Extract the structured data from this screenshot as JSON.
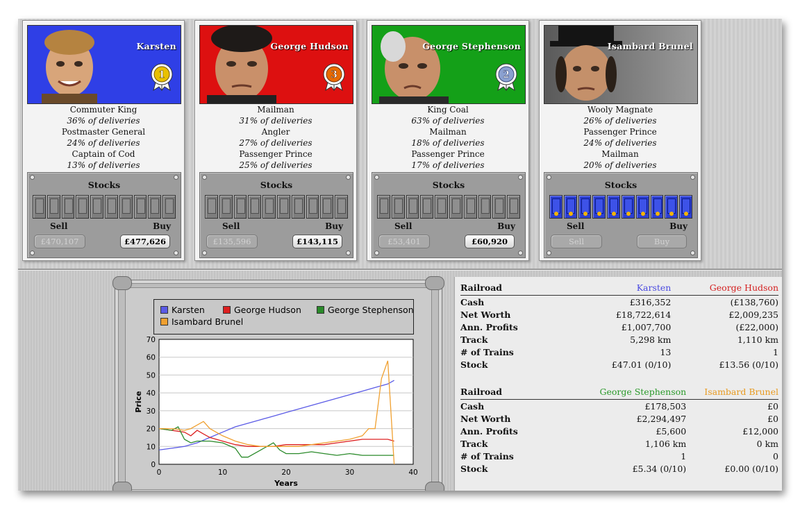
{
  "players": [
    {
      "name": "Karsten",
      "rank": "1",
      "bg": "#2f3fe6",
      "rank_color": "#e8c000",
      "achievements": [
        {
          "title": "Commuter King",
          "pct": "36% of deliveries"
        },
        {
          "title": "Postmaster General",
          "pct": "24% of deliveries"
        },
        {
          "title": "Captain of Cod",
          "pct": "13% of deliveries"
        }
      ],
      "stocks_label": "Stocks",
      "sell_label": "Sell",
      "buy_label": "Buy",
      "sell_value": "£470,107",
      "buy_value": "£477,626",
      "owned": 0,
      "buy_enabled": true
    },
    {
      "name": "George Hudson",
      "rank": "3",
      "bg": "#dd1010",
      "rank_color": "#e86a00",
      "achievements": [
        {
          "title": "Mailman",
          "pct": "31% of deliveries"
        },
        {
          "title": "Angler",
          "pct": "27% of deliveries"
        },
        {
          "title": "Passenger Prince",
          "pct": "25% of deliveries"
        }
      ],
      "stocks_label": "Stocks",
      "sell_label": "Sell",
      "buy_label": "Buy",
      "sell_value": "£135,596",
      "buy_value": "£143,115",
      "owned": 0,
      "buy_enabled": true
    },
    {
      "name": "George Stephenson",
      "rank": "2",
      "bg": "#14a018",
      "rank_color": "#8aa0d0",
      "achievements": [
        {
          "title": "King Coal",
          "pct": "63% of deliveries"
        },
        {
          "title": "Mailman",
          "pct": "18% of deliveries"
        },
        {
          "title": "Passenger Prince",
          "pct": "17% of deliveries"
        }
      ],
      "stocks_label": "Stocks",
      "sell_label": "Sell",
      "buy_label": "Buy",
      "sell_value": "£53,401",
      "buy_value": "£60,920",
      "owned": 0,
      "buy_enabled": true
    },
    {
      "name": "Isambard Brunel",
      "rank": "",
      "bg": "#7a7a7a",
      "rank_color": "",
      "achievements": [
        {
          "title": "Wooly Magnate",
          "pct": "26% of deliveries"
        },
        {
          "title": "Passenger Prince",
          "pct": "24% of deliveries"
        },
        {
          "title": "Mailman",
          "pct": "20% of deliveries"
        }
      ],
      "stocks_label": "Stocks",
      "sell_label": "Sell",
      "buy_label": "Buy",
      "sell_value": "Sell",
      "buy_value": "Buy",
      "owned": 10,
      "buy_enabled": false
    }
  ],
  "chart_data": {
    "type": "line",
    "xlabel": "Years",
    "ylabel": "Price",
    "xlim": [
      0,
      40
    ],
    "ylim": [
      0,
      70
    ],
    "xticks": [
      0,
      10,
      20,
      30,
      40
    ],
    "yticks": [
      0,
      10,
      20,
      30,
      40,
      50,
      60,
      70
    ],
    "grid": "horizontal",
    "legend_placement": "top",
    "series": [
      {
        "name": "Karsten",
        "color": "#5a5ae6",
        "points": [
          [
            0,
            8
          ],
          [
            2,
            9
          ],
          [
            4,
            10
          ],
          [
            6,
            12
          ],
          [
            8,
            15
          ],
          [
            10,
            18
          ],
          [
            12,
            21
          ],
          [
            14,
            23
          ],
          [
            16,
            25
          ],
          [
            18,
            27
          ],
          [
            20,
            29
          ],
          [
            22,
            31
          ],
          [
            24,
            33
          ],
          [
            26,
            35
          ],
          [
            28,
            37
          ],
          [
            30,
            39
          ],
          [
            32,
            41
          ],
          [
            34,
            43
          ],
          [
            36,
            45
          ],
          [
            37,
            47
          ]
        ]
      },
      {
        "name": "George Hudson",
        "color": "#dd2020",
        "points": [
          [
            0,
            20
          ],
          [
            2,
            19
          ],
          [
            4,
            18
          ],
          [
            5,
            16
          ],
          [
            6,
            19
          ],
          [
            7,
            17
          ],
          [
            8,
            15
          ],
          [
            10,
            13
          ],
          [
            12,
            11
          ],
          [
            14,
            10
          ],
          [
            16,
            10
          ],
          [
            18,
            10
          ],
          [
            20,
            11
          ],
          [
            22,
            11
          ],
          [
            24,
            11
          ],
          [
            26,
            11
          ],
          [
            28,
            12
          ],
          [
            30,
            13
          ],
          [
            32,
            14
          ],
          [
            34,
            14
          ],
          [
            36,
            14
          ],
          [
            37,
            13
          ]
        ]
      },
      {
        "name": "George Stephenson",
        "color": "#2a8a2a",
        "points": [
          [
            0,
            20
          ],
          [
            2,
            19
          ],
          [
            3,
            21
          ],
          [
            4,
            14
          ],
          [
            5,
            12
          ],
          [
            6,
            13
          ],
          [
            8,
            13
          ],
          [
            10,
            12
          ],
          [
            12,
            9
          ],
          [
            13,
            4
          ],
          [
            14,
            4
          ],
          [
            16,
            8
          ],
          [
            18,
            12
          ],
          [
            19,
            8
          ],
          [
            20,
            6
          ],
          [
            22,
            6
          ],
          [
            24,
            7
          ],
          [
            26,
            6
          ],
          [
            28,
            5
          ],
          [
            30,
            6
          ],
          [
            32,
            5
          ],
          [
            34,
            5
          ],
          [
            36,
            5
          ],
          [
            37,
            5
          ]
        ]
      },
      {
        "name": "Isambard Brunel",
        "color": "#f0a030",
        "points": [
          [
            0,
            20
          ],
          [
            2,
            20
          ],
          [
            4,
            19
          ],
          [
            5,
            20
          ],
          [
            6,
            22
          ],
          [
            7,
            24
          ],
          [
            8,
            20
          ],
          [
            10,
            16
          ],
          [
            12,
            13
          ],
          [
            14,
            11
          ],
          [
            16,
            10
          ],
          [
            18,
            10
          ],
          [
            20,
            10
          ],
          [
            22,
            10
          ],
          [
            24,
            11
          ],
          [
            26,
            12
          ],
          [
            28,
            13
          ],
          [
            30,
            14
          ],
          [
            32,
            16
          ],
          [
            33,
            20
          ],
          [
            34,
            20
          ],
          [
            35,
            48
          ],
          [
            36,
            58
          ],
          [
            37,
            0
          ]
        ]
      }
    ]
  },
  "finance": [
    {
      "header": "Railroad",
      "names": [
        "Karsten",
        "George Hudson"
      ],
      "colors": [
        "#4a4ae0",
        "#d42020"
      ],
      "rows": [
        {
          "label": "Cash",
          "values": [
            "£316,352",
            "(£138,760)"
          ]
        },
        {
          "label": "Net Worth",
          "values": [
            "£18,722,614",
            "£2,009,235"
          ]
        },
        {
          "label": "Ann. Profits",
          "values": [
            "£1,007,700",
            "(£22,000)"
          ]
        },
        {
          "label": "Track",
          "values": [
            "5,298 km",
            "1,110 km"
          ]
        },
        {
          "label": "# of Trains",
          "values": [
            "13",
            "1"
          ]
        },
        {
          "label": "Stock",
          "values": [
            "£47.01 (0/10)",
            "£13.56 (0/10)"
          ]
        }
      ]
    },
    {
      "header": "Railroad",
      "names": [
        "George Stephenson",
        "Isambard Brunel"
      ],
      "colors": [
        "#2a9a2a",
        "#e89a20"
      ],
      "rows": [
        {
          "label": "Cash",
          "values": [
            "£178,503",
            "£0"
          ]
        },
        {
          "label": "Net Worth",
          "values": [
            "£2,294,497",
            "£0"
          ]
        },
        {
          "label": "Ann. Profits",
          "values": [
            "£5,600",
            "£12,000"
          ]
        },
        {
          "label": "Track",
          "values": [
            "1,106 km",
            "0 km"
          ]
        },
        {
          "label": "# of Trains",
          "values": [
            "1",
            "0"
          ]
        },
        {
          "label": "Stock",
          "values": [
            "£5.34 (0/10)",
            "£0.00 (0/10)"
          ]
        }
      ]
    }
  ]
}
